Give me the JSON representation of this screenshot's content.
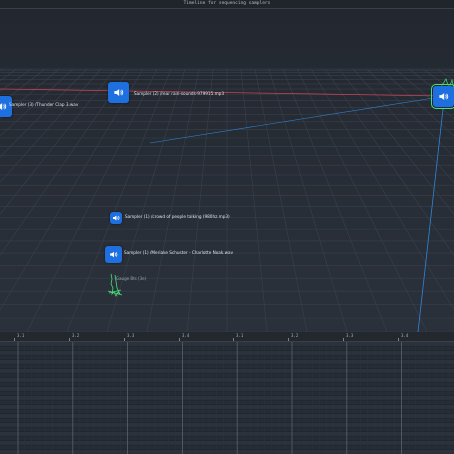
{
  "window": {
    "title": "Timeline for sequencing samplers"
  },
  "nodes": [
    {
      "label": "Sampler (3) /Thunder Clap 3.wav",
      "icon": "speaker-icon"
    },
    {
      "label": "Sampler (2) /rear rain-sounds-979915.mp3",
      "icon": "speaker-icon"
    },
    {
      "label": "",
      "icon": "speaker-icon"
    },
    {
      "label": "Sampler (1) /crowd of people talking (980hz.mp3)",
      "icon": "speaker-icon"
    },
    {
      "label": "Sampler (1) /Meriake Schuster - Charlotte Noak.wav",
      "icon": "speaker-icon"
    }
  ],
  "group_label": "Gauge Bts (3e)",
  "timeline": {
    "ticks": [
      "3.1",
      "3.2",
      "3.3",
      "3.4",
      "3.1",
      "3.2",
      "3.3",
      "3.4"
    ]
  },
  "colors": {
    "node": "#1e6fe0",
    "selection": "#49e07a",
    "link_red": "#c8455a",
    "link_blue": "#2f86d6"
  }
}
